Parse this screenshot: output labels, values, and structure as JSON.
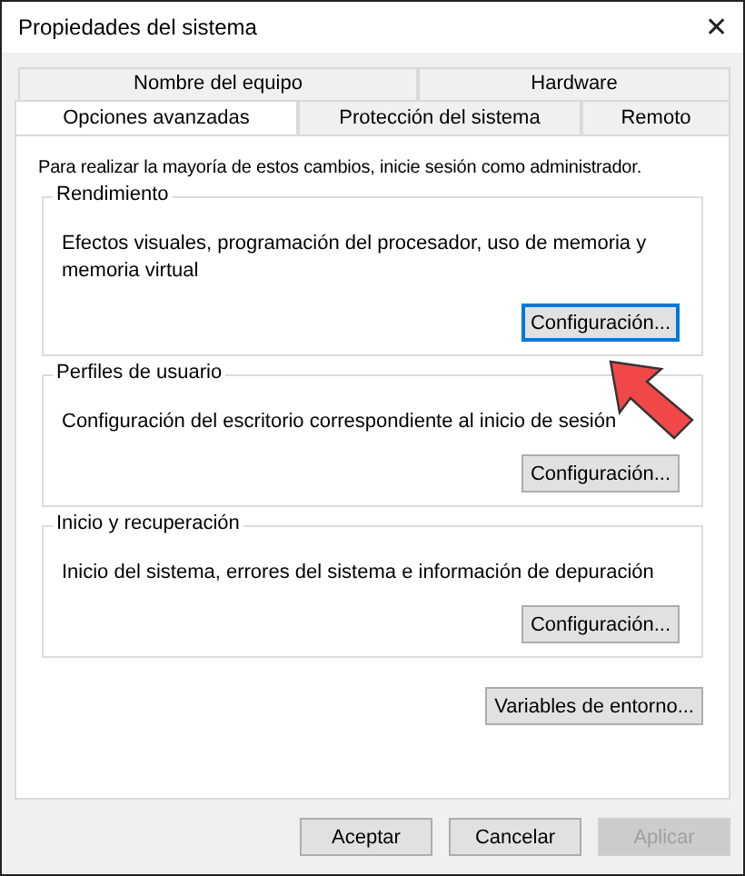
{
  "window": {
    "title": "Propiedades del sistema",
    "close": "✕"
  },
  "tab_rows": [
    [
      {
        "label": "Nombre del equipo",
        "selected": false
      },
      {
        "label": "Hardware",
        "selected": false
      }
    ],
    [
      {
        "label": "Opciones avanzadas",
        "selected": true
      },
      {
        "label": "Protección del sistema",
        "selected": false
      },
      {
        "label": "Remoto",
        "selected": false
      }
    ]
  ],
  "notice": "Para realizar la mayoría de estos cambios, inicie sesión como administrador.",
  "groups": [
    {
      "title": "Rendimiento",
      "text": "Efectos visuales, programación del procesador, uso de memoria y memoria virtual",
      "button": {
        "label": "Configuración...",
        "focused": true
      }
    },
    {
      "title": "Perfiles de usuario",
      "text": "Configuración del escritorio correspondiente al inicio de sesión",
      "button": {
        "label": "Configuración...",
        "focused": false
      }
    },
    {
      "title": "Inicio y recuperación",
      "text": "Inicio del sistema, errores del sistema e información de depuración",
      "button": {
        "label": "Configuración...",
        "focused": false
      }
    }
  ],
  "env_button": {
    "label": "Variables de entorno..."
  },
  "buttons": [
    {
      "label": "Aceptar",
      "disabled": false
    },
    {
      "label": "Cancelar",
      "disabled": false
    },
    {
      "label": "Aplicar",
      "disabled": true
    }
  ]
}
